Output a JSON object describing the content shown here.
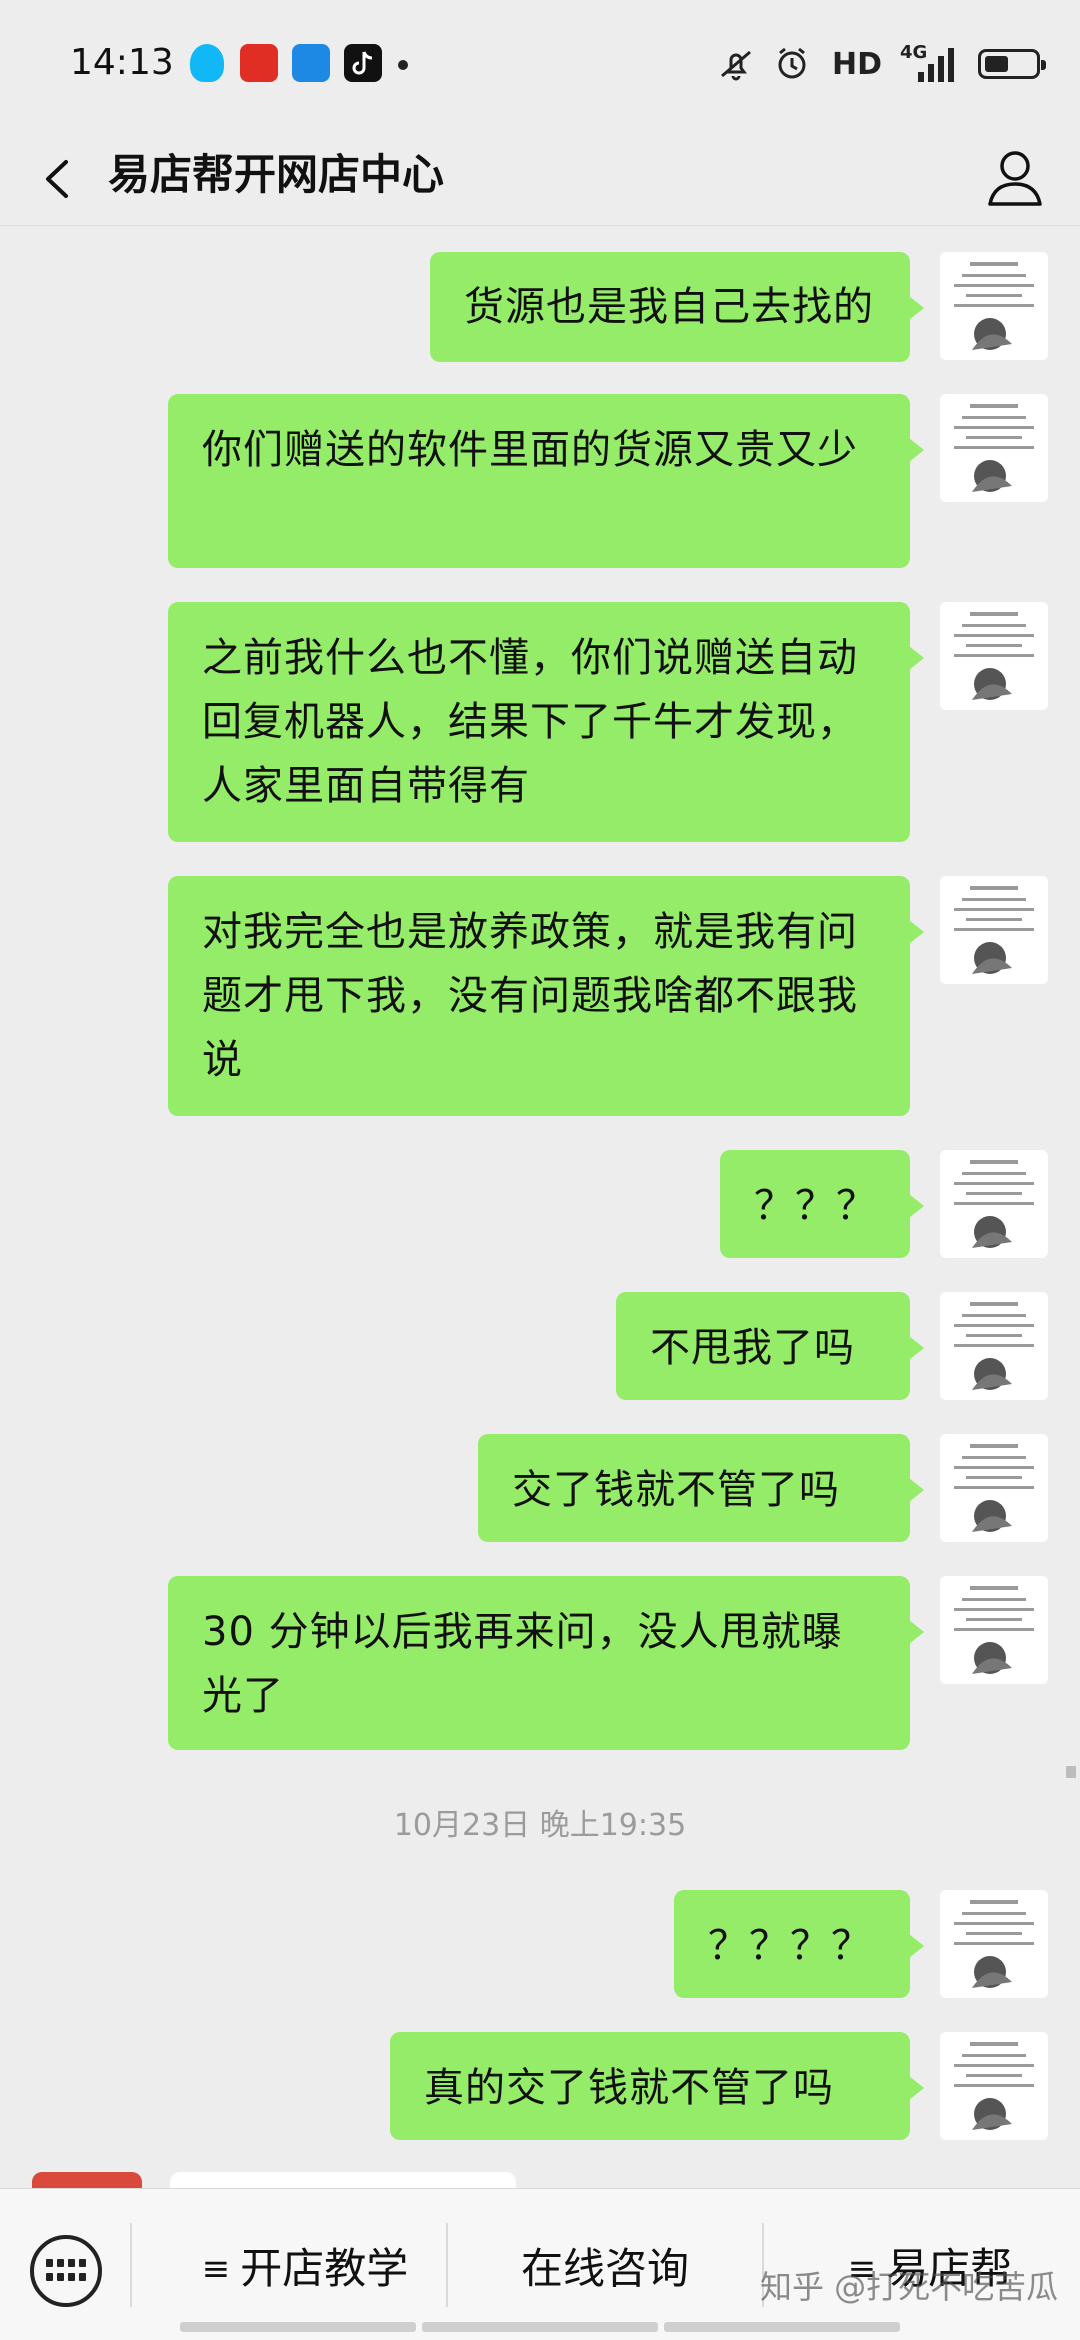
{
  "status_bar": {
    "time": "14:13",
    "hd_label": "HD",
    "network_label": "4G",
    "notification_icons": [
      "qq-icon",
      "pinduoduo-icon",
      "calculator-icon",
      "tiktok-icon"
    ],
    "battery_level": 0.45
  },
  "header": {
    "title": "易店帮开网店中心"
  },
  "messages": [
    {
      "text": "货源也是我自己去找的"
    },
    {
      "text": "你们赠送的软件里面的货源又贵又少"
    },
    {
      "text": "之前我什么也不懂，你们说赠送自动回复机器人，结果下了千牛才发现，人家里面自带得有"
    },
    {
      "text": "对我完全也是放养政策，就是我有问题才甩下我，没有问题我啥都不跟我说"
    },
    {
      "text": "？？？"
    },
    {
      "text": "不甩我了吗"
    },
    {
      "text": "交了钱就不管了吗"
    },
    {
      "text": "30 分钟以后我再来问，没人甩就曝光了"
    },
    {
      "text": "？？？？"
    },
    {
      "text": "真的交了钱就不管了吗"
    }
  ],
  "timestamp": "10月23日 晚上19:35",
  "bottom_menu": {
    "items": [
      {
        "label": "开店教学",
        "icon": "≡"
      },
      {
        "label": "在线咨询",
        "icon": ""
      },
      {
        "label": "易店帮",
        "icon": "≡"
      }
    ]
  },
  "watermark": "知乎 @打死不吃苦瓜",
  "colors": {
    "bubble": "#95ec69",
    "background": "#ededed",
    "timestamp": "#9b9b9b"
  }
}
